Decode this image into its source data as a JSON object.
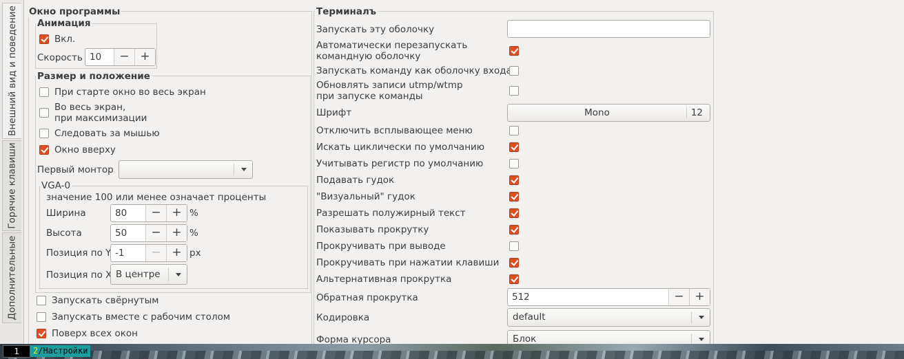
{
  "tabs": [
    "Внешний вид и поведение",
    "Горячие клавиши",
    "Дополнительные"
  ],
  "window": {
    "title": "Окно программы",
    "animation": {
      "title": "Анимация",
      "enabled_label": "Вкл.",
      "enabled": true,
      "speed_label": "Скорость",
      "speed_value": "10"
    },
    "size_position": {
      "title": "Размер и положение",
      "fullscreen_on_start": {
        "label": "При старте окно во весь экран",
        "checked": false
      },
      "fullscreen_on_maximize": {
        "label": "Во весь экран,\nпри максимизации",
        "checked": false
      },
      "follow_mouse": {
        "label": "Следовать за мышью",
        "checked": false
      },
      "window_on_top": {
        "label": "Окно вверху",
        "checked": true
      },
      "first_monitor_label": "Первый монтор",
      "first_monitor_value": "",
      "vga": {
        "title": "VGA-0",
        "hint": "значение 100 или менее означает проценты",
        "width_label": "Ширина",
        "width_value": "80",
        "width_unit": "%",
        "height_label": "Высота",
        "height_value": "50",
        "height_unit": "%",
        "posy_label": "Позиция по Y",
        "posy_value": "-1",
        "posy_unit": "px",
        "posx_label": "Позиция по X",
        "posx_value": "В центре"
      }
    },
    "start_minimized": {
      "label": "Запускать свёрнутым",
      "checked": false
    },
    "start_with_desktop": {
      "label": "Запускать вместе с рабочим столом",
      "checked": false
    },
    "above_all": {
      "label": "Поверх всех окон",
      "checked": true
    }
  },
  "terminal": {
    "title": "Терминалъ",
    "shell_label": "Запускать эту оболочку",
    "shell_value": "",
    "auto_restart": {
      "label": "Автоматически перезапускать\nкомандную оболочку",
      "checked": true
    },
    "login_shell": {
      "label": "Запускать команду как оболочку входа",
      "checked": false
    },
    "utmp": {
      "label": "Обновлять записи utmp/wtmp\nпри запуске команды",
      "checked": false
    },
    "font_label": "Шрифт",
    "font_name": "Mono",
    "font_size": "12",
    "disable_popup": {
      "label": "Отключить всплывающее меню",
      "checked": false
    },
    "cyclic_search": {
      "label": "Искать циклически по умолчанию",
      "checked": true
    },
    "case_search": {
      "label": "Учитывать регистр по умолчанию",
      "checked": false
    },
    "bell": {
      "label": "Подавать гудок",
      "checked": true
    },
    "visual_bell": {
      "label": "\"Визуальный\" гудок",
      "checked": true
    },
    "bold_text": {
      "label": "Разрешать полужирный текст",
      "checked": true
    },
    "show_scrollbar": {
      "label": "Показывать прокрутку",
      "checked": true
    },
    "scroll_output": {
      "label": "Прокручивать при выводе",
      "checked": false
    },
    "scroll_keystroke": {
      "label": "Прокручивать при нажатии клавиши",
      "checked": true
    },
    "alt_scroll": {
      "label": "Альтернативная прокрутка",
      "checked": true
    },
    "scrollback_label": "Обратная прокрутка",
    "scrollback_value": "512",
    "encoding_label": "Кодировка",
    "encoding_value": "default",
    "cursor_label": "Форма курсора",
    "cursor_value": "Блок"
  },
  "taskbar": {
    "workspace_1": "1",
    "workspace_2_num": "2",
    "workspace_2_label": "/Настройки"
  },
  "colors": {
    "accent": "#dd4f22",
    "window_bg": "#f2f1f0"
  }
}
